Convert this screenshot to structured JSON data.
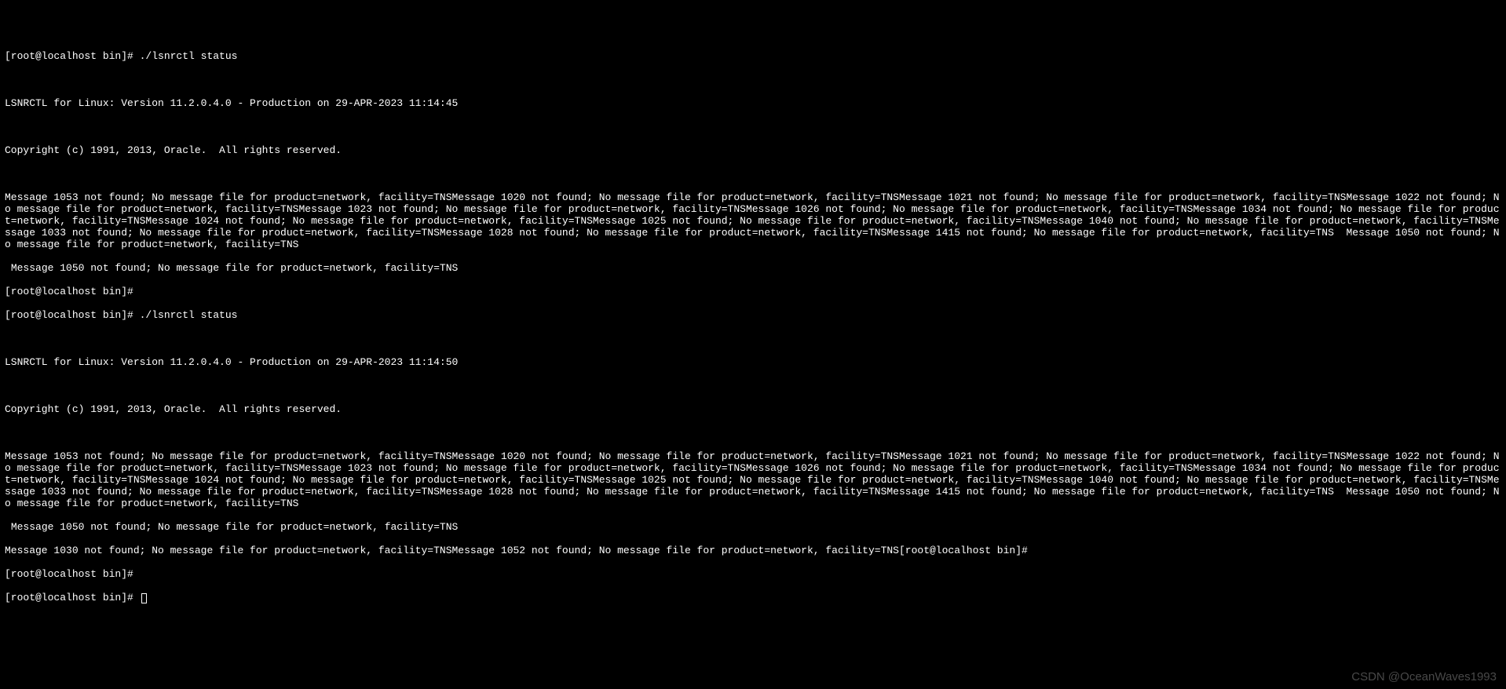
{
  "prompt1": "[root@localhost bin]# ./lsnrctl status",
  "block1": {
    "header": "LSNRCTL for Linux: Version 11.2.0.4.0 - Production on 29-APR-2023 11:14:45",
    "copyright": "Copyright (c) 1991, 2013, Oracle.  All rights reserved.",
    "body": "Message 1053 not found; No message file for product=network, facility=TNSMessage 1020 not found; No message file for product=network, facility=TNSMessage 1021 not found; No message file for product=network, facility=TNSMessage 1022 not found; No message file for product=network, facility=TNSMessage 1023 not found; No message file for product=network, facility=TNSMessage 1026 not found; No message file for product=network, facility=TNSMessage 1034 not found; No message file for product=network, facility=TNSMessage 1024 not found; No message file for product=network, facility=TNSMessage 1025 not found; No message file for product=network, facility=TNSMessage 1040 not found; No message file for product=network, facility=TNSMessage 1033 not found; No message file for product=network, facility=TNSMessage 1028 not found; No message file for product=network, facility=TNSMessage 1415 not found; No message file for product=network, facility=TNS  Message 1050 not found; No message file for product=network, facility=TNS",
    "tail": " Message 1050 not found; No message file for product=network, facility=TNS"
  },
  "prompt2": "[root@localhost bin]#",
  "prompt3": "[root@localhost bin]# ./lsnrctl status",
  "block2": {
    "header": "LSNRCTL for Linux: Version 11.2.0.4.0 - Production on 29-APR-2023 11:14:50",
    "copyright": "Copyright (c) 1991, 2013, Oracle.  All rights reserved.",
    "body": "Message 1053 not found; No message file for product=network, facility=TNSMessage 1020 not found; No message file for product=network, facility=TNSMessage 1021 not found; No message file for product=network, facility=TNSMessage 1022 not found; No message file for product=network, facility=TNSMessage 1023 not found; No message file for product=network, facility=TNSMessage 1026 not found; No message file for product=network, facility=TNSMessage 1034 not found; No message file for product=network, facility=TNSMessage 1024 not found; No message file for product=network, facility=TNSMessage 1025 not found; No message file for product=network, facility=TNSMessage 1040 not found; No message file for product=network, facility=TNSMessage 1033 not found; No message file for product=network, facility=TNSMessage 1028 not found; No message file for product=network, facility=TNSMessage 1415 not found; No message file for product=network, facility=TNS  Message 1050 not found; No message file for product=network, facility=TNS",
    "tail": " Message 1050 not found; No message file for product=network, facility=TNS",
    "extra": "Message 1030 not found; No message file for product=network, facility=TNSMessage 1052 not found; No message file for product=network, facility=TNS[root@localhost bin]#"
  },
  "prompt4": "[root@localhost bin]#",
  "prompt5": "[root@localhost bin]# ",
  "watermark": "CSDN @OceanWaves1993"
}
